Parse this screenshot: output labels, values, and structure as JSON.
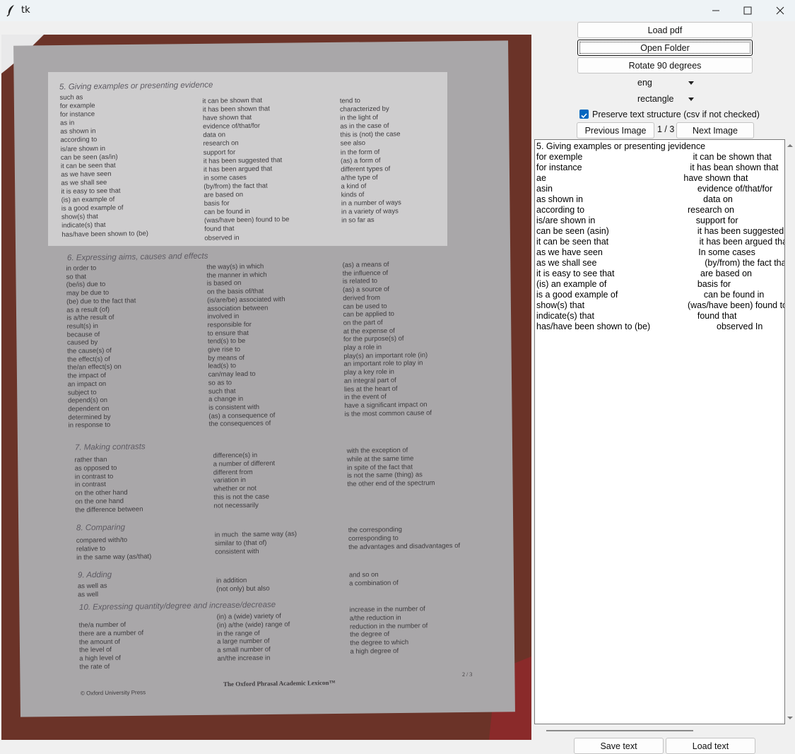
{
  "window": {
    "title": "tk"
  },
  "controls": {
    "load_pdf": "Load pdf",
    "open_folder": "Open Folder",
    "rotate": "Rotate 90 degrees",
    "language": "eng",
    "shape": "rectangle",
    "preserve_label": "Preserve text structure (csv if not checked)",
    "preserve_checked": true,
    "prev": "Previous Image",
    "page_counter": "1 / 3",
    "next": "Next Image",
    "save": "Save text",
    "load_text": "Load text"
  },
  "ocr_lines": [
    "5. Giving examples or presenting jevidence",
    "for exemple                                             it can be shown that",
    "for instance                                            it has bean shown that",
    "ae                                                        have shown that",
    "asin                                                           evidence of/that/for",
    "as shown in                                                 data on",
    "according to                                          research on",
    "is/are shown in                                         support for",
    "can be seen (asin)                                    it has been suggested that",
    "it can be seen that                                     it has been argued that",
    "as we have seen                                       In some cases",
    "as we shall see                                            (by/from) the fact that",
    "it is easy to see that                                   are based on",
    "(is) an example of                                     basis for",
    "is a good example of                                   can be found in",
    "show(s) that                                          (was/have been) found to be",
    "indicate(s) that                                          found that",
    "has/have been shown to (be)                           observed In"
  ],
  "document": {
    "sections": [
      {
        "heading": "5.  Giving examples or presenting evidence",
        "col1": "such as\nfor example\nfor instance\nas in\nas shown in\naccording to\nis/are shown in\ncan be seen (as/in)\nit can be seen that\nas we have seen\nas we shall see\nit is easy to see that\n(is) an example of\nis a good example of\nshow(s) that\nindicate(s) that\nhas/have been shown to (be)",
        "col2": "it can be shown that\nit has been shown that\nhave shown that\nevidence of/that/for\ndata on\nresearch on\nsupport for\nit has been suggested that\nit has been argued that\nin some cases\n(by/from) the fact that\nare based on\nbasis for\ncan be found in\n(was/have been) found to be\nfound that\nobserved in",
        "col3": "tend to\ncharacterized by\nin the light of\nas in the case of\nthis is (not) the case\nsee also\nin the form of\n(as) a form of\ndifferent types of\na/the type of\na kind of\nkinds of\nin a number of ways\nin a variety of ways\nin so far as"
      },
      {
        "heading": "6.  Expressing aims, causes and effects",
        "col1": "in order to\nso that\n(be/is) due to\nmay be due to\n(be) due to the fact that\nas a result (of)\nis a/the result of\nresult(s) in\nbecause of\ncaused by\nthe cause(s) of\nthe effect(s) of\nthe/an effect(s) on\nthe impact of\nan impact on\nsubject to\ndepend(s) on\ndependent on\ndetermined by\nin response to",
        "col2": "the way(s) in which\nthe manner in which\nis based on\non the basis of/that\n(is/are/be) associated with\nassociation between\ninvolved in\nresponsible for\nto ensure that\ntend(s) to be\ngive rise to\nby means of\nlead(s) to\ncan/may lead to\nso as to\nsuch that\na change in\nis consistent with\n(as) a consequence of\nthe consequences of",
        "col3": "(as) a means of\nthe influence of\nis related to\n(as) a source of\nderived from\ncan be used to\ncan be applied to\non the part of\nat the expense of\nfor the purpose(s) of\nplay a role in\nplay(s) an important role (in)\nan important role to play in\nplay a key role in\nan integral part of\nlies at the heart of\nin the event of\nhave a significant impact on\nis the most common cause of"
      },
      {
        "heading": "7.  Making contrasts",
        "col1": "rather than\nas opposed to\nin contrast to\nin contrast\non the other hand\non the one hand\nthe difference between",
        "col2": "difference(s) in\na number of different\ndifferent from\nvariation in\nwhether or not\nthis is not the case\nnot necessarily",
        "col3": "with the exception of\nwhile at the same time\nin spite of the fact that\nis not the same (thing) as\nthe other end of the spectrum"
      },
      {
        "heading": "8.  Comparing",
        "col1": "compared with/to\nrelative to\nin the same way (as/that)",
        "col2": "in much  the same way (as)\nsimilar to (that of)\nconsistent with",
        "col3": "the corresponding\ncorresponding to\nthe advantages and disadvantages of"
      },
      {
        "heading": "9.  Adding",
        "col1": "as well as\nas well",
        "col2": "in addition\n(not only) but also",
        "col3": "and so on\na combination of"
      },
      {
        "heading": "10. Expressing quantity/degree and increase/decrease",
        "col1": "the/a number of\nthere are a number of\nthe amount of\nthe level of\na high level of\nthe rate of",
        "col2": "(in) a (wide) variety of\n(in) a/the (wide) range of\nin the range of\na large number of\na small number of\nan/the increase in",
        "col3": "increase in the number of\na/the reduction in\nreduction in the number of\nthe degree of\nthe degree to which\na high degree of"
      }
    ],
    "footer_left": "© Oxford University Press",
    "footer_center": "The Oxford Phrasal Academic Lexicon™",
    "page_mark": "2 / 3"
  }
}
